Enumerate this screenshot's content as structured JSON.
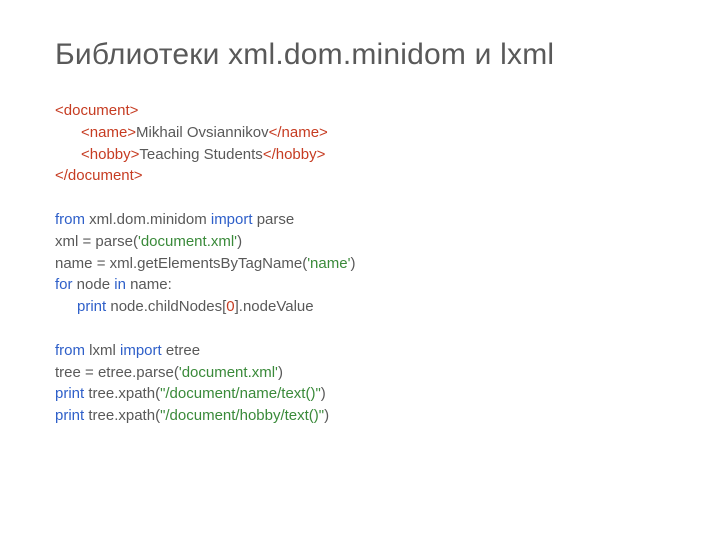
{
  "title": "Библиотеки xml.dom.minidom и lxml",
  "xml": {
    "l1": "<document>",
    "l2a": "<name>",
    "l2b": "Mikhail Ovsiannikov",
    "l2c": "</name>",
    "l3a": "<hobby>",
    "l3b": "Teaching Students",
    "l3c": "</hobby>",
    "l4": "</document>"
  },
  "py1": {
    "l1a": "from",
    "l1b": " xml.dom.minidom ",
    "l1c": "import",
    "l1d": " parse",
    "l2a": "xml = parse(",
    "l2b": "'document.xml'",
    "l2c": ")",
    "l3a": "name = xml.getElementsByTagName(",
    "l3b": "'name'",
    "l3c": ")",
    "l4a": "for",
    "l4b": " node ",
    "l4c": "in",
    "l4d": " name:",
    "l5a": "print",
    "l5b": " node.childNodes[",
    "l5c": "0",
    "l5d": "].nodeValue"
  },
  "py2": {
    "l1a": "from",
    "l1b": " lxml ",
    "l1c": "import",
    "l1d": " etree",
    "l2a": "tree = etree.parse(",
    "l2b": "'document.xml'",
    "l2c": ")",
    "l3a": "print",
    "l3b": " tree.xpath(",
    "l3c": "\"/document/name/text()\"",
    "l3d": ")",
    "l4a": "print",
    "l4b": " tree.xpath(",
    "l4c": "\"/document/hobby/text()\"",
    "l4d": ")"
  }
}
